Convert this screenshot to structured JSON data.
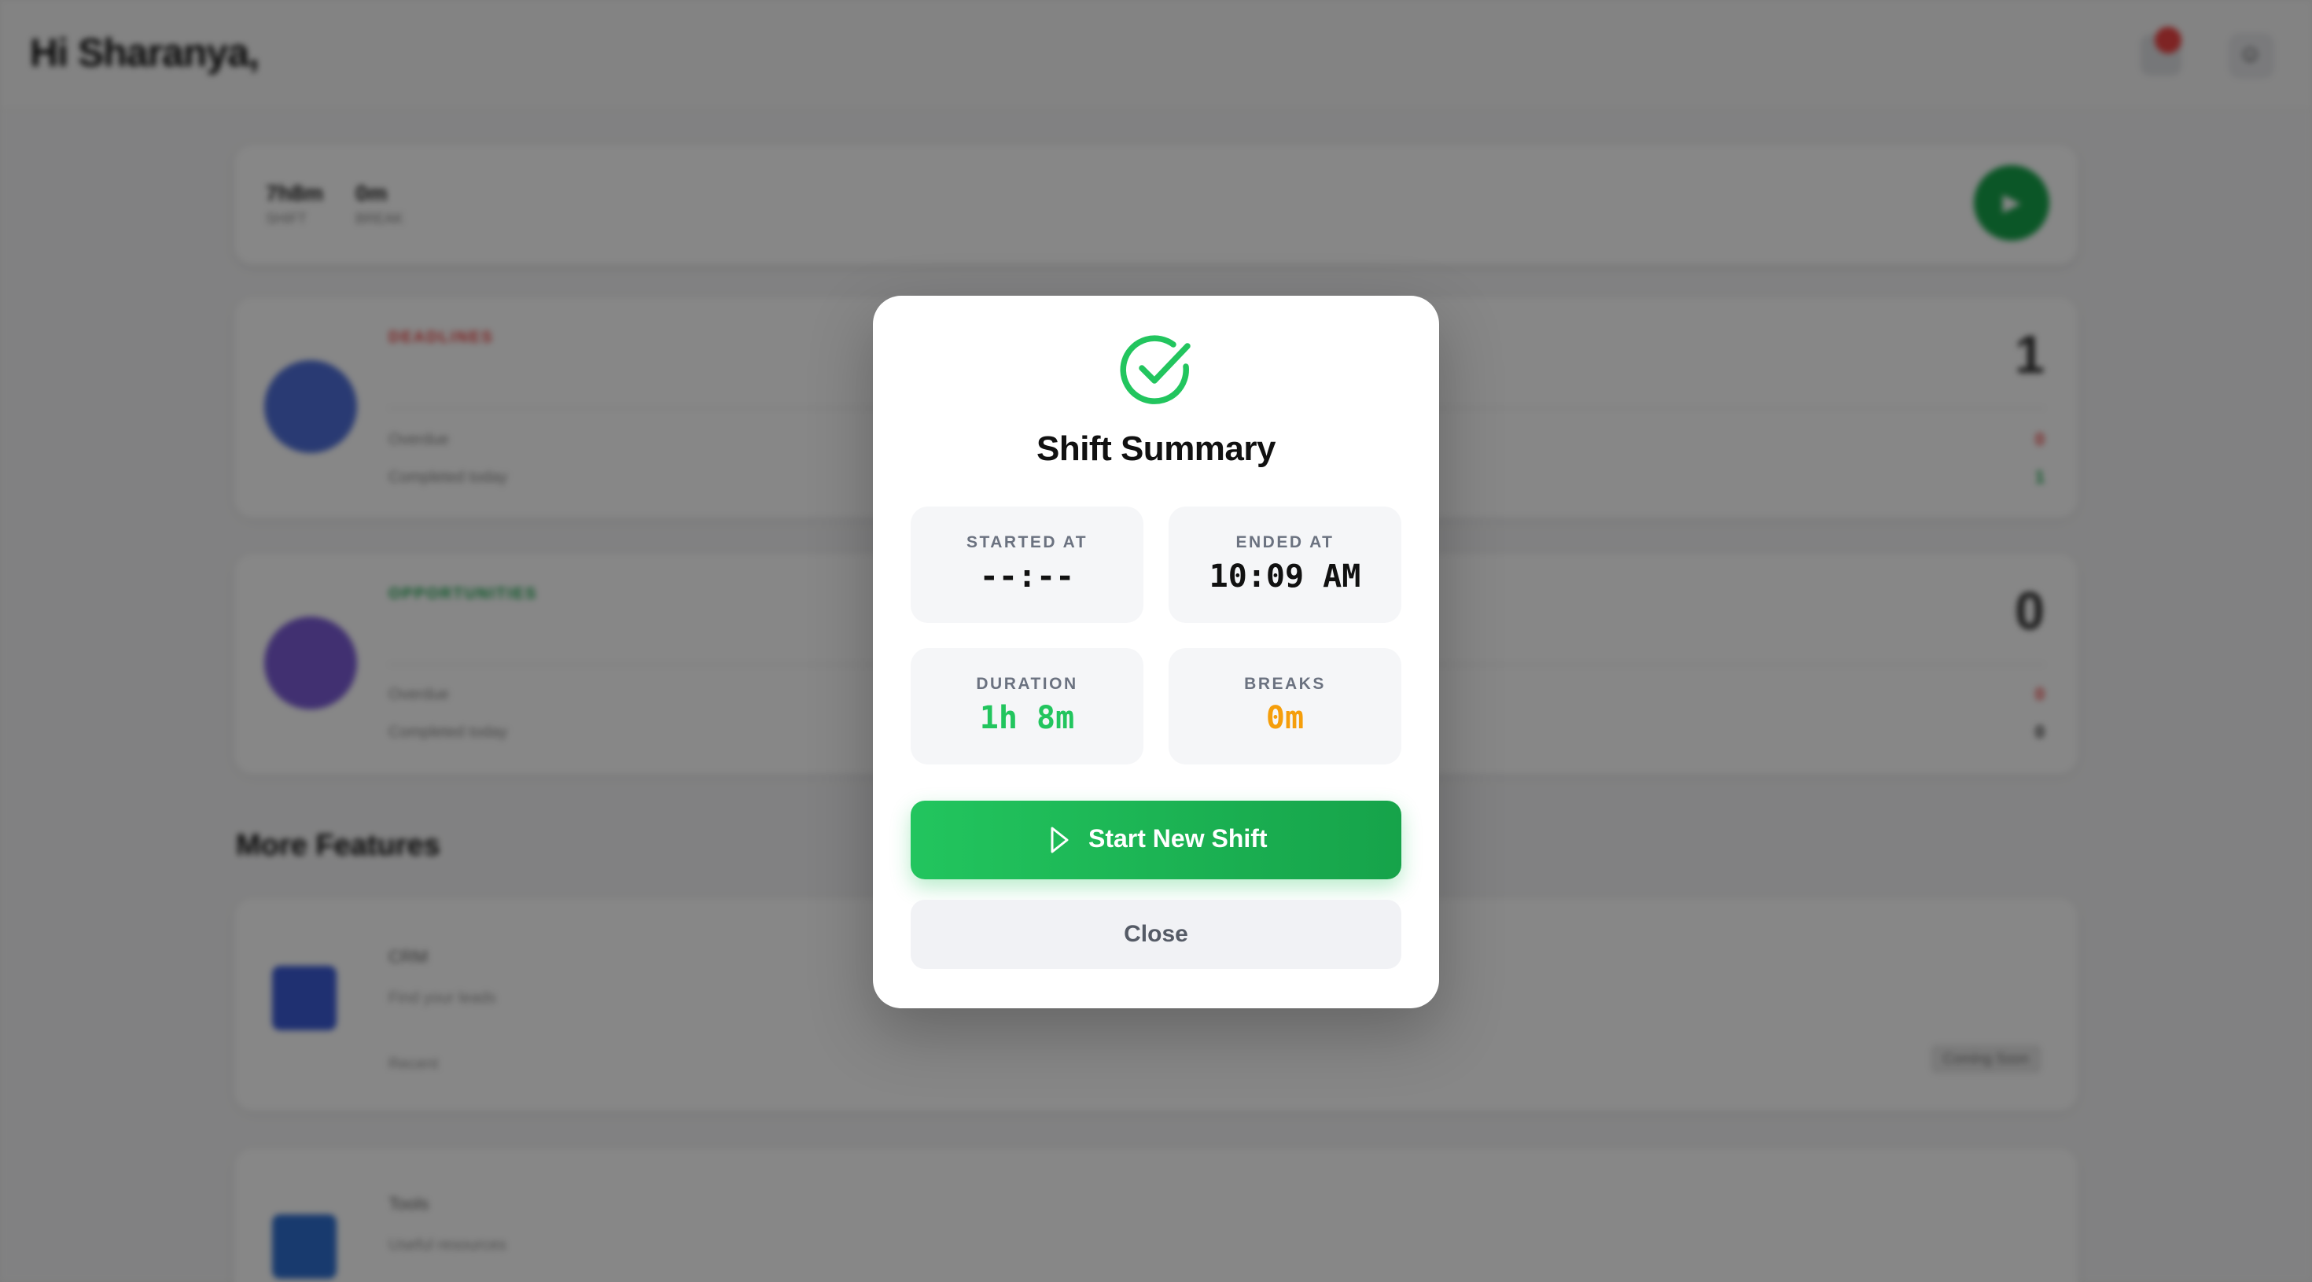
{
  "background": {
    "greeting": "Hi Sharanya,",
    "status_card": {
      "stat1_value": "7h8m",
      "stat1_label": "SHIFT",
      "stat2_value": "0m",
      "stat2_label": "BREAK",
      "go_label": "▶"
    },
    "card1": {
      "tag": "DEADLINES",
      "row1": "Overdue",
      "row2": "Completed today",
      "count": "1",
      "row1_value": "0",
      "row2_value": "1"
    },
    "card2": {
      "tag": "OPPORTUNITIES",
      "row1": "Overdue",
      "row2": "Completed today",
      "count": "0",
      "row1_value": "0",
      "row2_value": "0"
    },
    "section_title": "More Features",
    "feature1": {
      "title": "CRM",
      "subtitle": "Find your leads",
      "row": "Recent",
      "pill": "Coming Soon"
    },
    "feature2": {
      "title": "Tools",
      "subtitle": "Useful resources"
    },
    "accent_red": "#ef4444",
    "accent_green": "#16a34a"
  },
  "modal": {
    "title": "Shift Summary",
    "icon": "check-circle-icon",
    "tiles": [
      {
        "label": "STARTED AT",
        "value": "--:--",
        "color": "#111111"
      },
      {
        "label": "ENDED AT",
        "value": "10:09 AM",
        "color": "#111111"
      },
      {
        "label": "DURATION",
        "value": "1h 8m",
        "color": "#22c55e"
      },
      {
        "label": "BREAKS",
        "value": "0m",
        "color": "#f59e0b"
      }
    ],
    "primary_button": {
      "label": "Start New Shift",
      "icon": "play-icon",
      "color": "#22c55e"
    },
    "secondary_button": {
      "label": "Close"
    }
  }
}
